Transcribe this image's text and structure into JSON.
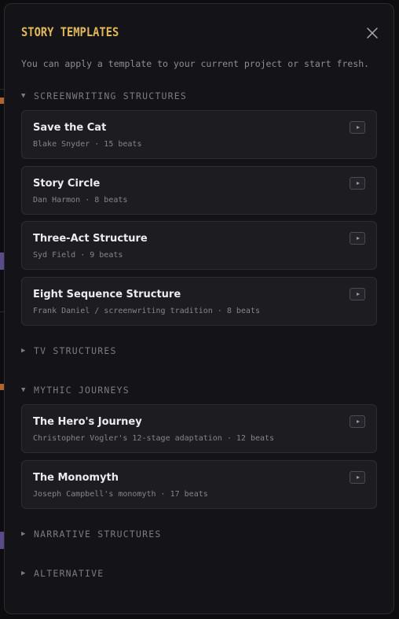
{
  "dialog": {
    "title": "STORY TEMPLATES",
    "subtitle": "You can apply a template to your current project or start fresh.",
    "close_icon": "close-icon"
  },
  "colors": {
    "title": "#e0b85a",
    "background": "#141418",
    "card": "#1c1c21",
    "card_title": "#ececef",
    "meta": "#85858d"
  },
  "sections": [
    {
      "name": "SCREENWRITING STRUCTURES",
      "expanded": true,
      "caret_icon": "caret-down-icon",
      "caret": "▼",
      "templates": [
        {
          "title": "Save the Cat",
          "meta": "Blake Snyder · 15 beats",
          "action_icon": "play-icon"
        },
        {
          "title": "Story Circle",
          "meta": "Dan Harmon · 8 beats",
          "action_icon": "play-icon"
        },
        {
          "title": "Three-Act Structure",
          "meta": "Syd Field · 9 beats",
          "action_icon": "play-icon"
        },
        {
          "title": "Eight Sequence Structure",
          "meta": "Frank Daniel / screenwriting tradition · 8 beats",
          "action_icon": "play-icon"
        }
      ]
    },
    {
      "name": "TV STRUCTURES",
      "expanded": false,
      "caret_icon": "caret-right-icon",
      "caret": "▶",
      "templates": []
    },
    {
      "name": "MYTHIC JOURNEYS",
      "expanded": true,
      "caret_icon": "caret-down-icon",
      "caret": "▼",
      "templates": [
        {
          "title": "The Hero's Journey",
          "meta": "Christopher Vogler's 12-stage adaptation · 12 beats",
          "action_icon": "play-icon"
        },
        {
          "title": "The Monomyth",
          "meta": "Joseph Campbell's monomyth · 17 beats",
          "action_icon": "play-icon"
        }
      ]
    },
    {
      "name": "NARRATIVE STRUCTURES",
      "expanded": false,
      "caret_icon": "caret-right-icon",
      "caret": "▶",
      "templates": []
    },
    {
      "name": "ALTERNATIVE",
      "expanded": false,
      "caret_icon": "caret-right-icon",
      "caret": "▶",
      "templates": []
    }
  ]
}
